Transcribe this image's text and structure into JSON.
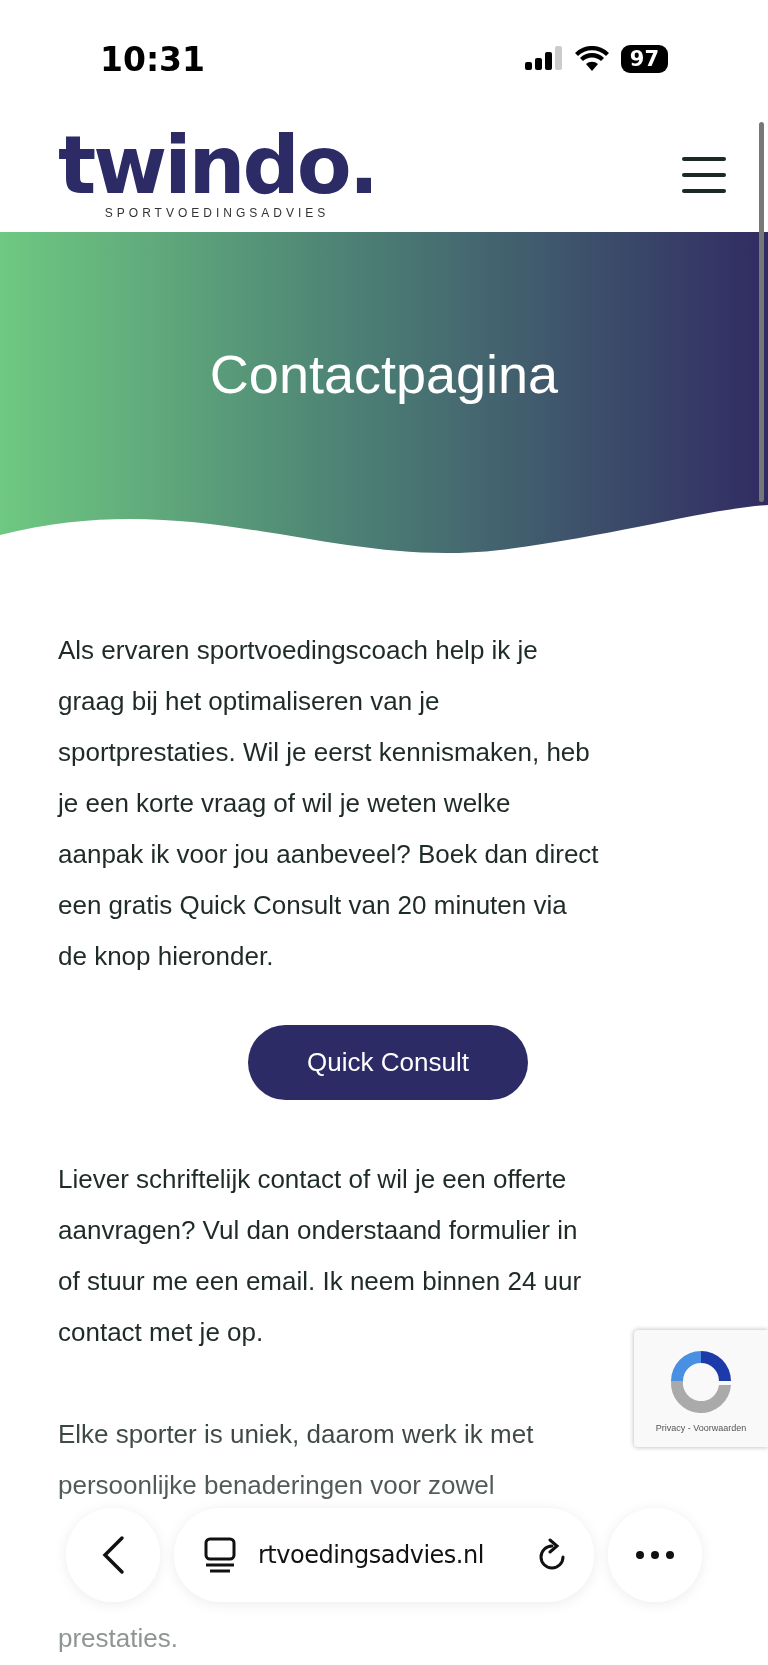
{
  "status_bar": {
    "time": "10:31",
    "battery": "97"
  },
  "header": {
    "logo": "twindo.",
    "tagline": "SPORTVOEDINGSADVIES"
  },
  "hero": {
    "title": "Contactpagina"
  },
  "content": {
    "intro_lines": [
      "Als ervaren sportvoedingscoach help ik je",
      "graag bij het optimaliseren van je",
      "sportprestaties. Wil je eerst kennismaken, heb",
      "je een korte vraag of wil je weten welke",
      "aanpak ik voor jou aanbeveel? Boek dan direct",
      "een gratis Quick Consult van 20 minuten via",
      "de knop hieronder."
    ],
    "button": "Quick Consult",
    "written_lines": [
      "Liever schriftelijk contact of wil je een offerte",
      "aanvragen? Vul dan onderstaand formulier in",
      "of stuur me een email. Ik neem binnen 24 uur",
      "contact met je op."
    ],
    "unique_lines": [
      "Elke sporter is uniek, daarom werk ik met",
      "persoonlijke benaderingen voor zowel"
    ],
    "unique_tail": "prestaties."
  },
  "recaptcha": {
    "links": "Privacy - Voorwaarden"
  },
  "browser_bar": {
    "url": "rtvoedingsadvies.nl"
  }
}
